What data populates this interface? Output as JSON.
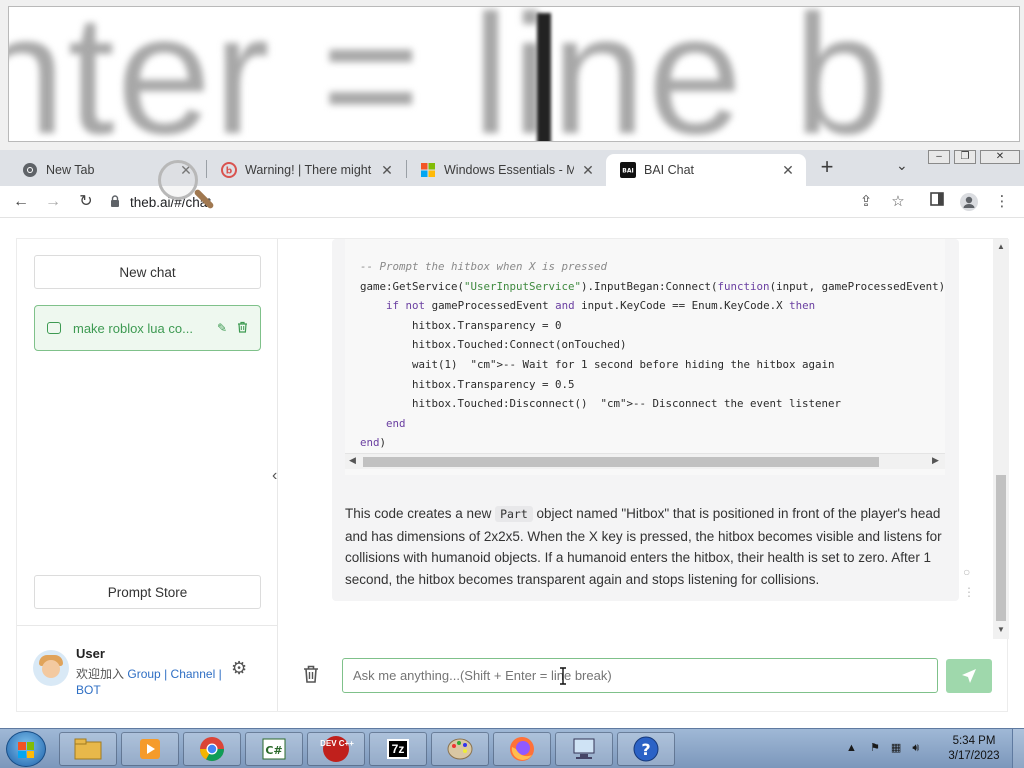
{
  "magnifier": {
    "zoomed_text": "nter = line b"
  },
  "tabs": [
    {
      "title": "New Tab",
      "icon": "chrome-icon"
    },
    {
      "title": "Warning! | There might be",
      "icon": "warning-site-icon"
    },
    {
      "title": "Windows Essentials - Mic",
      "icon": "windows-icon"
    },
    {
      "title": "BAI Chat",
      "icon": "bai-icon",
      "active": true
    }
  ],
  "browser": {
    "url": "theb.ai/#/chat",
    "tab_close": "✕",
    "new_tab": "+",
    "tab_dropdown": "⌄"
  },
  "sidebar": {
    "new_chat": "New chat",
    "chat_item": "make roblox lua co...",
    "prompt_store": "Prompt Store",
    "user_name": "User",
    "user_prefix": "欢迎加入",
    "link_group": "Group",
    "link_sep": "|",
    "link_channel": "Channel",
    "link_bot": "BOT"
  },
  "code_lines": [
    {
      "t": "-- Prompt the hitbox when X is pressed",
      "c": "cm"
    },
    {
      "t": "game:GetService(\"UserInputService\").InputBegan:Connect(function(input, gameProcessedEvent)"
    },
    {
      "t": "    if not gameProcessedEvent and input.KeyCode == Enum.KeyCode.X then"
    },
    {
      "t": "        hitbox.Transparency = 0"
    },
    {
      "t": "        hitbox.Touched:Connect(onTouched)"
    },
    {
      "t": "        wait(1)  -- Wait for 1 second before hiding the hitbox again"
    },
    {
      "t": "        hitbox.Transparency = 0.5"
    },
    {
      "t": "        hitbox.Touched:Disconnect()  -- Disconnect the event listener"
    },
    {
      "t": "    end"
    },
    {
      "t": "end)"
    }
  ],
  "answer": {
    "before": "This code creates a new ",
    "inline_code": "Part",
    "after": " object named \"Hitbox\" that is positioned in front of the player's head and has dimensions of 2x2x5. When the X key is pressed, the hitbox becomes visible and listens for collisions with humanoid objects. If a humanoid enters the hitbox, their health is set to zero. After 1 second, the hitbox becomes transparent again and stops listening for collisions."
  },
  "input": {
    "placeholder": "Ask me anything...(Shift + Enter = line break)"
  },
  "taskbar": {
    "apps": [
      "file-explorer",
      "media-player",
      "chrome",
      "csharp-editor",
      "devcpp",
      "7zip",
      "paint",
      "firefox",
      "network-tool",
      "help"
    ],
    "devcpp_label": "DEV C++",
    "zip_label": "7z",
    "clock_time": "5:34 PM",
    "clock_date": "3/17/2023"
  },
  "colors": {
    "accent_green": "#3d9a52",
    "send_button": "#9fd8ac",
    "tab_bar": "#dee1e6"
  }
}
